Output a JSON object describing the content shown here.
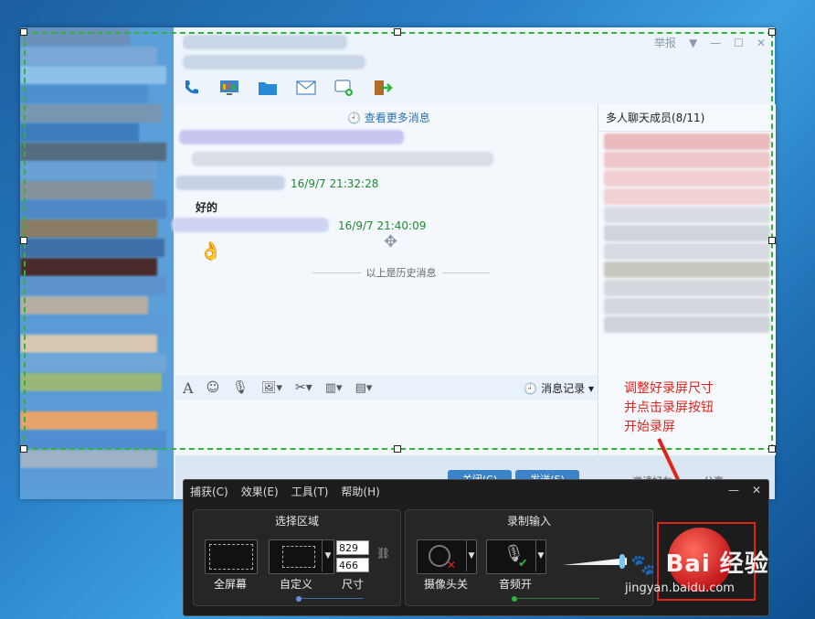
{
  "chat": {
    "report_label": "举报",
    "load_more": "查看更多消息",
    "messages": [
      {
        "time": "16/9/7 21:32:28",
        "text": "好的"
      },
      {
        "time": "16/9/7 21:40:09"
      }
    ],
    "history_label": "以上是历史消息",
    "members_title": "多人聊天成员(8/11)",
    "record_label": "消息记录",
    "close_label": "关闭(C)",
    "send_label": "发送(S)",
    "invite_label": "邀请好友",
    "share_label": "分享"
  },
  "annotation": [
    "调整好录屏尺寸",
    "并点击录屏按钮",
    "开始录屏"
  ],
  "recorder": {
    "menu": [
      "捕获(C)",
      "效果(E)",
      "工具(T)",
      "帮助(H)"
    ],
    "select_region_title": "选择区域",
    "record_input_title": "录制输入",
    "fullscreen_label": "全屏幕",
    "custom_label": "自定义",
    "size_label": "尺寸",
    "width": "829",
    "height": "466",
    "camera_label": "摄像头关",
    "audio_label": "音频开"
  },
  "watermark": {
    "brand": "Bai 经验",
    "url": "jingyan.baidu.com"
  },
  "colors": {
    "selection": "#2fb43a",
    "annotation": "#e0231a",
    "accent": "#3c84c9"
  }
}
